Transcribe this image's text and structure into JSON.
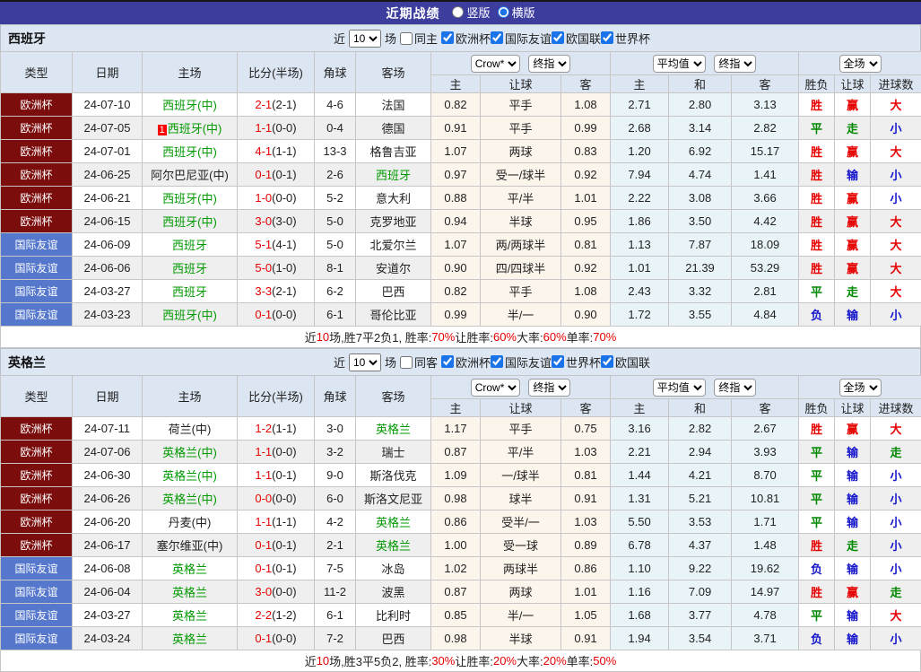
{
  "title_bar": {
    "title": "近期战绩",
    "radios": [
      {
        "label": "竖版",
        "checked": false
      },
      {
        "label": "横版",
        "checked": true
      }
    ]
  },
  "colors": {
    "titlebar_bg": "#3d3d9e",
    "euro_type_bg": "#7b0d0d",
    "friendly_type_bg": "#5577cc",
    "team_green": "#009900",
    "score_red": "#e60000",
    "win_red": "#e60000",
    "draw_green": "#008800",
    "lose_blue": "#1414cc",
    "header_bg": "#dce6f2",
    "handicap_col_bg": "#fcf5ec",
    "average_col_bg": "#e9f4f8",
    "alt_row_bg": "#efefef"
  },
  "sections": [
    {
      "team": "西班牙",
      "filter": {
        "recent_label": "近",
        "count": "10",
        "games_label": "场",
        "same_side_label": "同主",
        "same_side_checked": false,
        "leagues": [
          {
            "label": "欧洲杯",
            "checked": true
          },
          {
            "label": "国际友谊",
            "checked": true
          },
          {
            "label": "欧国联",
            "checked": true
          },
          {
            "label": "世界杯",
            "checked": true
          }
        ]
      },
      "odds_header": {
        "cols": [
          "类型",
          "日期",
          "主场",
          "比分(半场)",
          "角球",
          "客场"
        ],
        "group1": {
          "dd": [
            "Crow*",
            "终指"
          ],
          "subs": [
            "主",
            "让球",
            "客"
          ]
        },
        "group2": {
          "dd": [
            "平均值",
            "终指"
          ],
          "subs": [
            "主",
            "和",
            "客"
          ]
        },
        "group3": {
          "dd": [
            "全场"
          ],
          "subs": [
            "胜负",
            "让球",
            "进球数"
          ]
        }
      },
      "rows": [
        {
          "league": "欧洲杯",
          "style": "euro",
          "date": "24-07-10",
          "badge": "",
          "home": "西班牙(中)",
          "homeGreen": true,
          "score": "2-1",
          "half": "(2-1)",
          "corner": "4-6",
          "away": "法国",
          "awayGreen": false,
          "h1": "0.82",
          "hc": "平手",
          "h2": "1.08",
          "m1": "2.71",
          "m2": "2.80",
          "m3": "3.13",
          "r1": "胜",
          "c1": "red",
          "r2": "赢",
          "c2": "red",
          "r3": "大",
          "c3": "red"
        },
        {
          "league": "欧洲杯",
          "style": "euro",
          "date": "24-07-05",
          "badge": "1",
          "home": "西班牙(中)",
          "homeGreen": true,
          "score": "1-1",
          "half": "(0-0)",
          "corner": "0-4",
          "away": "德国",
          "awayGreen": false,
          "h1": "0.91",
          "hc": "平手",
          "h2": "0.99",
          "m1": "2.68",
          "m2": "3.14",
          "m3": "2.82",
          "r1": "平",
          "c1": "green",
          "r2": "走",
          "c2": "green",
          "r3": "小",
          "c3": "blue"
        },
        {
          "league": "欧洲杯",
          "style": "euro",
          "date": "24-07-01",
          "badge": "",
          "home": "西班牙(中)",
          "homeGreen": true,
          "score": "4-1",
          "half": "(1-1)",
          "corner": "13-3",
          "away": "格鲁吉亚",
          "awayGreen": false,
          "h1": "1.07",
          "hc": "两球",
          "h2": "0.83",
          "m1": "1.20",
          "m2": "6.92",
          "m3": "15.17",
          "r1": "胜",
          "c1": "red",
          "r2": "赢",
          "c2": "red",
          "r3": "大",
          "c3": "red"
        },
        {
          "league": "欧洲杯",
          "style": "euro",
          "date": "24-06-25",
          "badge": "",
          "home": "阿尔巴尼亚(中)",
          "homeGreen": false,
          "score": "0-1",
          "half": "(0-1)",
          "corner": "2-6",
          "away": "西班牙",
          "awayGreen": true,
          "h1": "0.97",
          "hc": "受一/球半",
          "h2": "0.92",
          "m1": "7.94",
          "m2": "4.74",
          "m3": "1.41",
          "r1": "胜",
          "c1": "red",
          "r2": "输",
          "c2": "blue",
          "r3": "小",
          "c3": "blue"
        },
        {
          "league": "欧洲杯",
          "style": "euro",
          "date": "24-06-21",
          "badge": "",
          "home": "西班牙(中)",
          "homeGreen": true,
          "score": "1-0",
          "half": "(0-0)",
          "corner": "5-2",
          "away": "意大利",
          "awayGreen": false,
          "h1": "0.88",
          "hc": "平/半",
          "h2": "1.01",
          "m1": "2.22",
          "m2": "3.08",
          "m3": "3.66",
          "r1": "胜",
          "c1": "red",
          "r2": "赢",
          "c2": "red",
          "r3": "小",
          "c3": "blue"
        },
        {
          "league": "欧洲杯",
          "style": "euro",
          "date": "24-06-15",
          "badge": "",
          "home": "西班牙(中)",
          "homeGreen": true,
          "score": "3-0",
          "half": "(3-0)",
          "corner": "5-0",
          "away": "克罗地亚",
          "awayGreen": false,
          "h1": "0.94",
          "hc": "半球",
          "h2": "0.95",
          "m1": "1.86",
          "m2": "3.50",
          "m3": "4.42",
          "r1": "胜",
          "c1": "red",
          "r2": "赢",
          "c2": "red",
          "r3": "大",
          "c3": "red"
        },
        {
          "league": "国际友谊",
          "style": "friendly",
          "date": "24-06-09",
          "badge": "",
          "home": "西班牙",
          "homeGreen": true,
          "score": "5-1",
          "half": "(4-1)",
          "corner": "5-0",
          "away": "北爱尔兰",
          "awayGreen": false,
          "h1": "1.07",
          "hc": "两/两球半",
          "h2": "0.81",
          "m1": "1.13",
          "m2": "7.87",
          "m3": "18.09",
          "r1": "胜",
          "c1": "red",
          "r2": "赢",
          "c2": "red",
          "r3": "大",
          "c3": "red"
        },
        {
          "league": "国际友谊",
          "style": "friendly",
          "date": "24-06-06",
          "badge": "",
          "home": "西班牙",
          "homeGreen": true,
          "score": "5-0",
          "half": "(1-0)",
          "corner": "8-1",
          "away": "安道尔",
          "awayGreen": false,
          "h1": "0.90",
          "hc": "四/四球半",
          "h2": "0.92",
          "m1": "1.01",
          "m2": "21.39",
          "m3": "53.29",
          "r1": "胜",
          "c1": "red",
          "r2": "赢",
          "c2": "red",
          "r3": "大",
          "c3": "red"
        },
        {
          "league": "国际友谊",
          "style": "friendly",
          "date": "24-03-27",
          "badge": "",
          "home": "西班牙",
          "homeGreen": true,
          "score": "3-3",
          "half": "(2-1)",
          "corner": "6-2",
          "away": "巴西",
          "awayGreen": false,
          "h1": "0.82",
          "hc": "平手",
          "h2": "1.08",
          "m1": "2.43",
          "m2": "3.32",
          "m3": "2.81",
          "r1": "平",
          "c1": "green",
          "r2": "走",
          "c2": "green",
          "r3": "大",
          "c3": "red"
        },
        {
          "league": "国际友谊",
          "style": "friendly",
          "date": "24-03-23",
          "badge": "",
          "home": "西班牙(中)",
          "homeGreen": true,
          "score": "0-1",
          "half": "(0-0)",
          "corner": "6-1",
          "away": "哥伦比亚",
          "awayGreen": false,
          "h1": "0.99",
          "hc": "半/一",
          "h2": "0.90",
          "m1": "1.72",
          "m2": "3.55",
          "m3": "4.84",
          "r1": "负",
          "c1": "blue",
          "r2": "输",
          "c2": "blue",
          "r3": "小",
          "c3": "blue"
        }
      ],
      "summary": {
        "parts": [
          {
            "text": "近",
            "red": false
          },
          {
            "text": "10",
            "red": true
          },
          {
            "text": "场,胜7平2负1, 胜率:",
            "red": false
          },
          {
            "text": "70%",
            "red": true
          },
          {
            "text": " 让胜率:",
            "red": false
          },
          {
            "text": "60%",
            "red": true
          },
          {
            "text": " 大率:",
            "red": false
          },
          {
            "text": "60%",
            "red": true
          },
          {
            "text": " 单率:",
            "red": false
          },
          {
            "text": "70%",
            "red": true
          }
        ]
      }
    },
    {
      "team": "英格兰",
      "filter": {
        "recent_label": "近",
        "count": "10",
        "games_label": "场",
        "same_side_label": "同客",
        "same_side_checked": false,
        "leagues": [
          {
            "label": "欧洲杯",
            "checked": true
          },
          {
            "label": "国际友谊",
            "checked": true
          },
          {
            "label": "世界杯",
            "checked": true
          },
          {
            "label": "欧国联",
            "checked": true
          }
        ]
      },
      "odds_header": {
        "cols": [
          "类型",
          "日期",
          "主场",
          "比分(半场)",
          "角球",
          "客场"
        ],
        "group1": {
          "dd": [
            "Crow*",
            "终指"
          ],
          "subs": [
            "主",
            "让球",
            "客"
          ]
        },
        "group2": {
          "dd": [
            "平均值",
            "终指"
          ],
          "subs": [
            "主",
            "和",
            "客"
          ]
        },
        "group3": {
          "dd": [
            "全场"
          ],
          "subs": [
            "胜负",
            "让球",
            "进球数"
          ]
        }
      },
      "rows": [
        {
          "league": "欧洲杯",
          "style": "euro",
          "date": "24-07-11",
          "badge": "",
          "home": "荷兰(中)",
          "homeGreen": false,
          "score": "1-2",
          "half": "(1-1)",
          "corner": "3-0",
          "away": "英格兰",
          "awayGreen": true,
          "h1": "1.17",
          "hc": "平手",
          "h2": "0.75",
          "m1": "3.16",
          "m2": "2.82",
          "m3": "2.67",
          "r1": "胜",
          "c1": "red",
          "r2": "赢",
          "c2": "red",
          "r3": "大",
          "c3": "red"
        },
        {
          "league": "欧洲杯",
          "style": "euro",
          "date": "24-07-06",
          "badge": "",
          "home": "英格兰(中)",
          "homeGreen": true,
          "score": "1-1",
          "half": "(0-0)",
          "corner": "3-2",
          "away": "瑞士",
          "awayGreen": false,
          "h1": "0.87",
          "hc": "平/半",
          "h2": "1.03",
          "m1": "2.21",
          "m2": "2.94",
          "m3": "3.93",
          "r1": "平",
          "c1": "green",
          "r2": "输",
          "c2": "blue",
          "r3": "走",
          "c3": "green"
        },
        {
          "league": "欧洲杯",
          "style": "euro",
          "date": "24-06-30",
          "badge": "",
          "home": "英格兰(中)",
          "homeGreen": true,
          "score": "1-1",
          "half": "(0-1)",
          "corner": "9-0",
          "away": "斯洛伐克",
          "awayGreen": false,
          "h1": "1.09",
          "hc": "一/球半",
          "h2": "0.81",
          "m1": "1.44",
          "m2": "4.21",
          "m3": "8.70",
          "r1": "平",
          "c1": "green",
          "r2": "输",
          "c2": "blue",
          "r3": "小",
          "c3": "blue"
        },
        {
          "league": "欧洲杯",
          "style": "euro",
          "date": "24-06-26",
          "badge": "",
          "home": "英格兰(中)",
          "homeGreen": true,
          "score": "0-0",
          "half": "(0-0)",
          "corner": "6-0",
          "away": "斯洛文尼亚",
          "awayGreen": false,
          "h1": "0.98",
          "hc": "球半",
          "h2": "0.91",
          "m1": "1.31",
          "m2": "5.21",
          "m3": "10.81",
          "r1": "平",
          "c1": "green",
          "r2": "输",
          "c2": "blue",
          "r3": "小",
          "c3": "blue"
        },
        {
          "league": "欧洲杯",
          "style": "euro",
          "date": "24-06-20",
          "badge": "",
          "home": "丹麦(中)",
          "homeGreen": false,
          "score": "1-1",
          "half": "(1-1)",
          "corner": "4-2",
          "away": "英格兰",
          "awayGreen": true,
          "h1": "0.86",
          "hc": "受半/一",
          "h2": "1.03",
          "m1": "5.50",
          "m2": "3.53",
          "m3": "1.71",
          "r1": "平",
          "c1": "green",
          "r2": "输",
          "c2": "blue",
          "r3": "小",
          "c3": "blue"
        },
        {
          "league": "欧洲杯",
          "style": "euro",
          "date": "24-06-17",
          "badge": "",
          "home": "塞尔维亚(中)",
          "homeGreen": false,
          "score": "0-1",
          "half": "(0-1)",
          "corner": "2-1",
          "away": "英格兰",
          "awayGreen": true,
          "h1": "1.00",
          "hc": "受一球",
          "h2": "0.89",
          "m1": "6.78",
          "m2": "4.37",
          "m3": "1.48",
          "r1": "胜",
          "c1": "red",
          "r2": "走",
          "c2": "green",
          "r3": "小",
          "c3": "blue"
        },
        {
          "league": "国际友谊",
          "style": "friendly",
          "date": "24-06-08",
          "badge": "",
          "home": "英格兰",
          "homeGreen": true,
          "score": "0-1",
          "half": "(0-1)",
          "corner": "7-5",
          "away": "冰岛",
          "awayGreen": false,
          "h1": "1.02",
          "hc": "两球半",
          "h2": "0.86",
          "m1": "1.10",
          "m2": "9.22",
          "m3": "19.62",
          "r1": "负",
          "c1": "blue",
          "r2": "输",
          "c2": "blue",
          "r3": "小",
          "c3": "blue"
        },
        {
          "league": "国际友谊",
          "style": "friendly",
          "date": "24-06-04",
          "badge": "",
          "home": "英格兰",
          "homeGreen": true,
          "score": "3-0",
          "half": "(0-0)",
          "corner": "11-2",
          "away": "波黑",
          "awayGreen": false,
          "h1": "0.87",
          "hc": "两球",
          "h2": "1.01",
          "m1": "1.16",
          "m2": "7.09",
          "m3": "14.97",
          "r1": "胜",
          "c1": "red",
          "r2": "赢",
          "c2": "red",
          "r3": "走",
          "c3": "green"
        },
        {
          "league": "国际友谊",
          "style": "friendly",
          "date": "24-03-27",
          "badge": "",
          "home": "英格兰",
          "homeGreen": true,
          "score": "2-2",
          "half": "(1-2)",
          "corner": "6-1",
          "away": "比利时",
          "awayGreen": false,
          "h1": "0.85",
          "hc": "半/一",
          "h2": "1.05",
          "m1": "1.68",
          "m2": "3.77",
          "m3": "4.78",
          "r1": "平",
          "c1": "green",
          "r2": "输",
          "c2": "blue",
          "r3": "大",
          "c3": "red"
        },
        {
          "league": "国际友谊",
          "style": "friendly",
          "date": "24-03-24",
          "badge": "",
          "home": "英格兰",
          "homeGreen": true,
          "score": "0-1",
          "half": "(0-0)",
          "corner": "7-2",
          "away": "巴西",
          "awayGreen": false,
          "h1": "0.98",
          "hc": "半球",
          "h2": "0.91",
          "m1": "1.94",
          "m2": "3.54",
          "m3": "3.71",
          "r1": "负",
          "c1": "blue",
          "r2": "输",
          "c2": "blue",
          "r3": "小",
          "c3": "blue"
        }
      ],
      "summary": {
        "parts": [
          {
            "text": "近",
            "red": false
          },
          {
            "text": "10",
            "red": true
          },
          {
            "text": "场,胜3平5负2, 胜率:",
            "red": false
          },
          {
            "text": "30%",
            "red": true
          },
          {
            "text": " 让胜率:",
            "red": false
          },
          {
            "text": "20%",
            "red": true
          },
          {
            "text": " 大率:",
            "red": false
          },
          {
            "text": "20%",
            "red": true
          },
          {
            "text": " 单率:",
            "red": false
          },
          {
            "text": "50%",
            "red": true
          }
        ]
      }
    }
  ]
}
